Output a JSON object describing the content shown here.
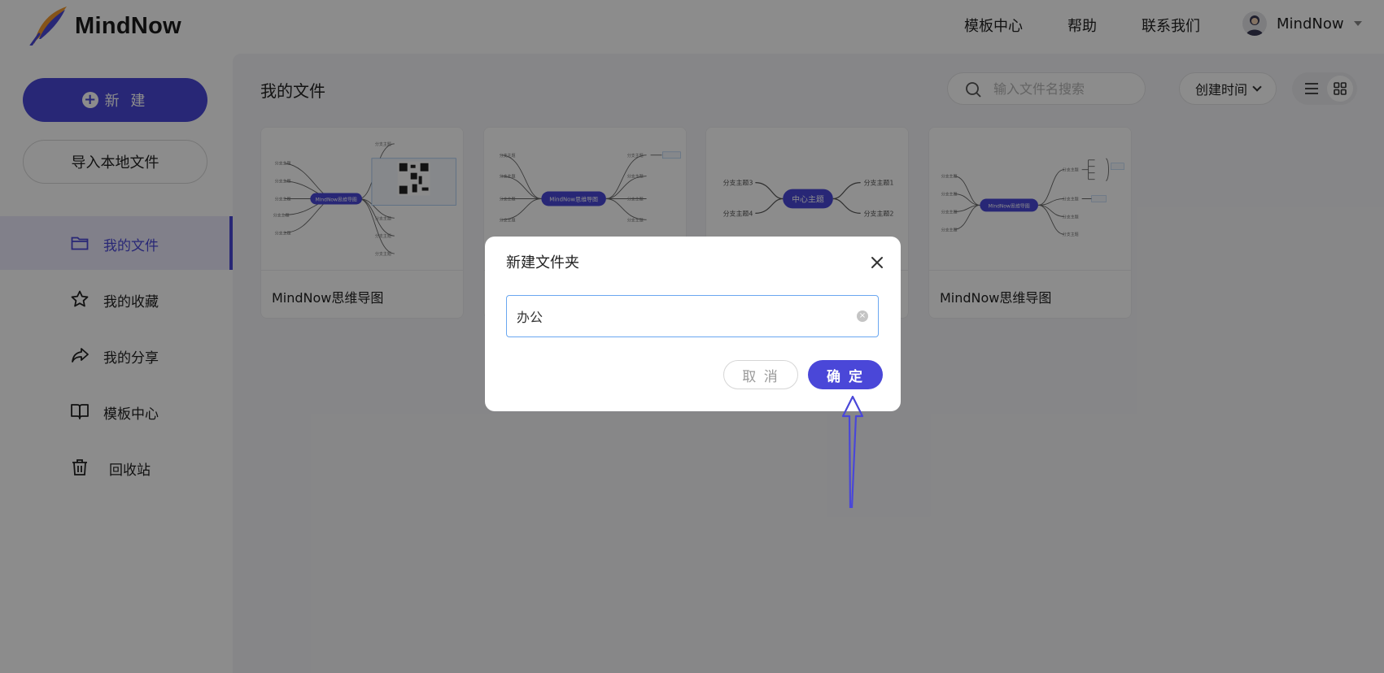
{
  "header": {
    "brand": "MindNow",
    "nav": [
      "模板中心",
      "帮助",
      "联系我们"
    ],
    "user_name": "MindNow"
  },
  "sidebar": {
    "new_label": "新 建",
    "import_label": "导入本地文件",
    "items": [
      {
        "label": "我的文件",
        "icon": "folder-icon",
        "active": true
      },
      {
        "label": "我的收藏",
        "icon": "star-icon"
      },
      {
        "label": "我的分享",
        "icon": "share-icon"
      },
      {
        "label": "模板中心",
        "icon": "book-icon"
      },
      {
        "label": "回收站",
        "icon": "trash-icon"
      }
    ]
  },
  "main": {
    "title": "我的文件",
    "search_placeholder": "输入文件名搜索",
    "sort_label": "创建时间",
    "files": [
      {
        "name": "MindNow思维导图",
        "center": "MindNow思维导图"
      },
      {
        "name": "",
        "center": "MindNow思维导图"
      },
      {
        "name": "",
        "center": "中心主题"
      },
      {
        "name": "MindNow思维导图",
        "center": "MindNow思维导图"
      }
    ],
    "thumb_branches": [
      "分支主题1",
      "分支主题2",
      "分支主题3",
      "分支主题4"
    ]
  },
  "dialog": {
    "title": "新建文件夹",
    "input_value": "办公",
    "cancel_label": "取 消",
    "ok_label": "确 定"
  },
  "colors": {
    "accent": "#4a47d8",
    "overlay": "rgba(0,0,0,0.45)",
    "input_border": "#6aa7f0"
  }
}
